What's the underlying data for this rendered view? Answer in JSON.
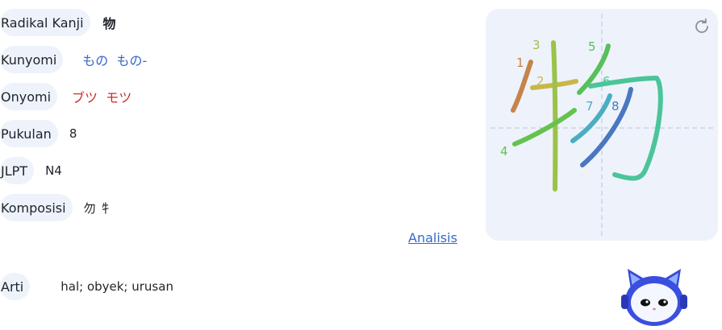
{
  "kanji": "物",
  "details": {
    "radical": {
      "label": "Radikal Kanji",
      "value": "物"
    },
    "kunyomi": {
      "label": "Kunyomi",
      "value": "もの  もの-"
    },
    "onyomi": {
      "label": "Onyomi",
      "value": "ブツ  モツ"
    },
    "strokes": {
      "label": "Pukulan",
      "value": "8"
    },
    "jlpt": {
      "label": "JLPT",
      "value": "N4"
    },
    "composition": {
      "label": "Komposisi",
      "value": "勿 牜"
    },
    "meaning": {
      "label": "Arti",
      "value": "hal; obyek; urusan"
    }
  },
  "analysis_link": "Analisis",
  "stroke_diagram": {
    "numbers": [
      "1",
      "2",
      "3",
      "4",
      "5",
      "6",
      "7",
      "8"
    ],
    "colors": {
      "s1": "#c4844a",
      "s2": "#c8b64a",
      "s3": "#9bc24a",
      "s4": "#66c24e",
      "s5": "#58c05a",
      "s6": "#4cc49a",
      "s7": "#4aaec0",
      "s8": "#4a78c0",
      "guide": "#b8c4dc"
    }
  },
  "icons": {
    "refresh": "refresh-icon",
    "mascot": "robot-mascot"
  }
}
